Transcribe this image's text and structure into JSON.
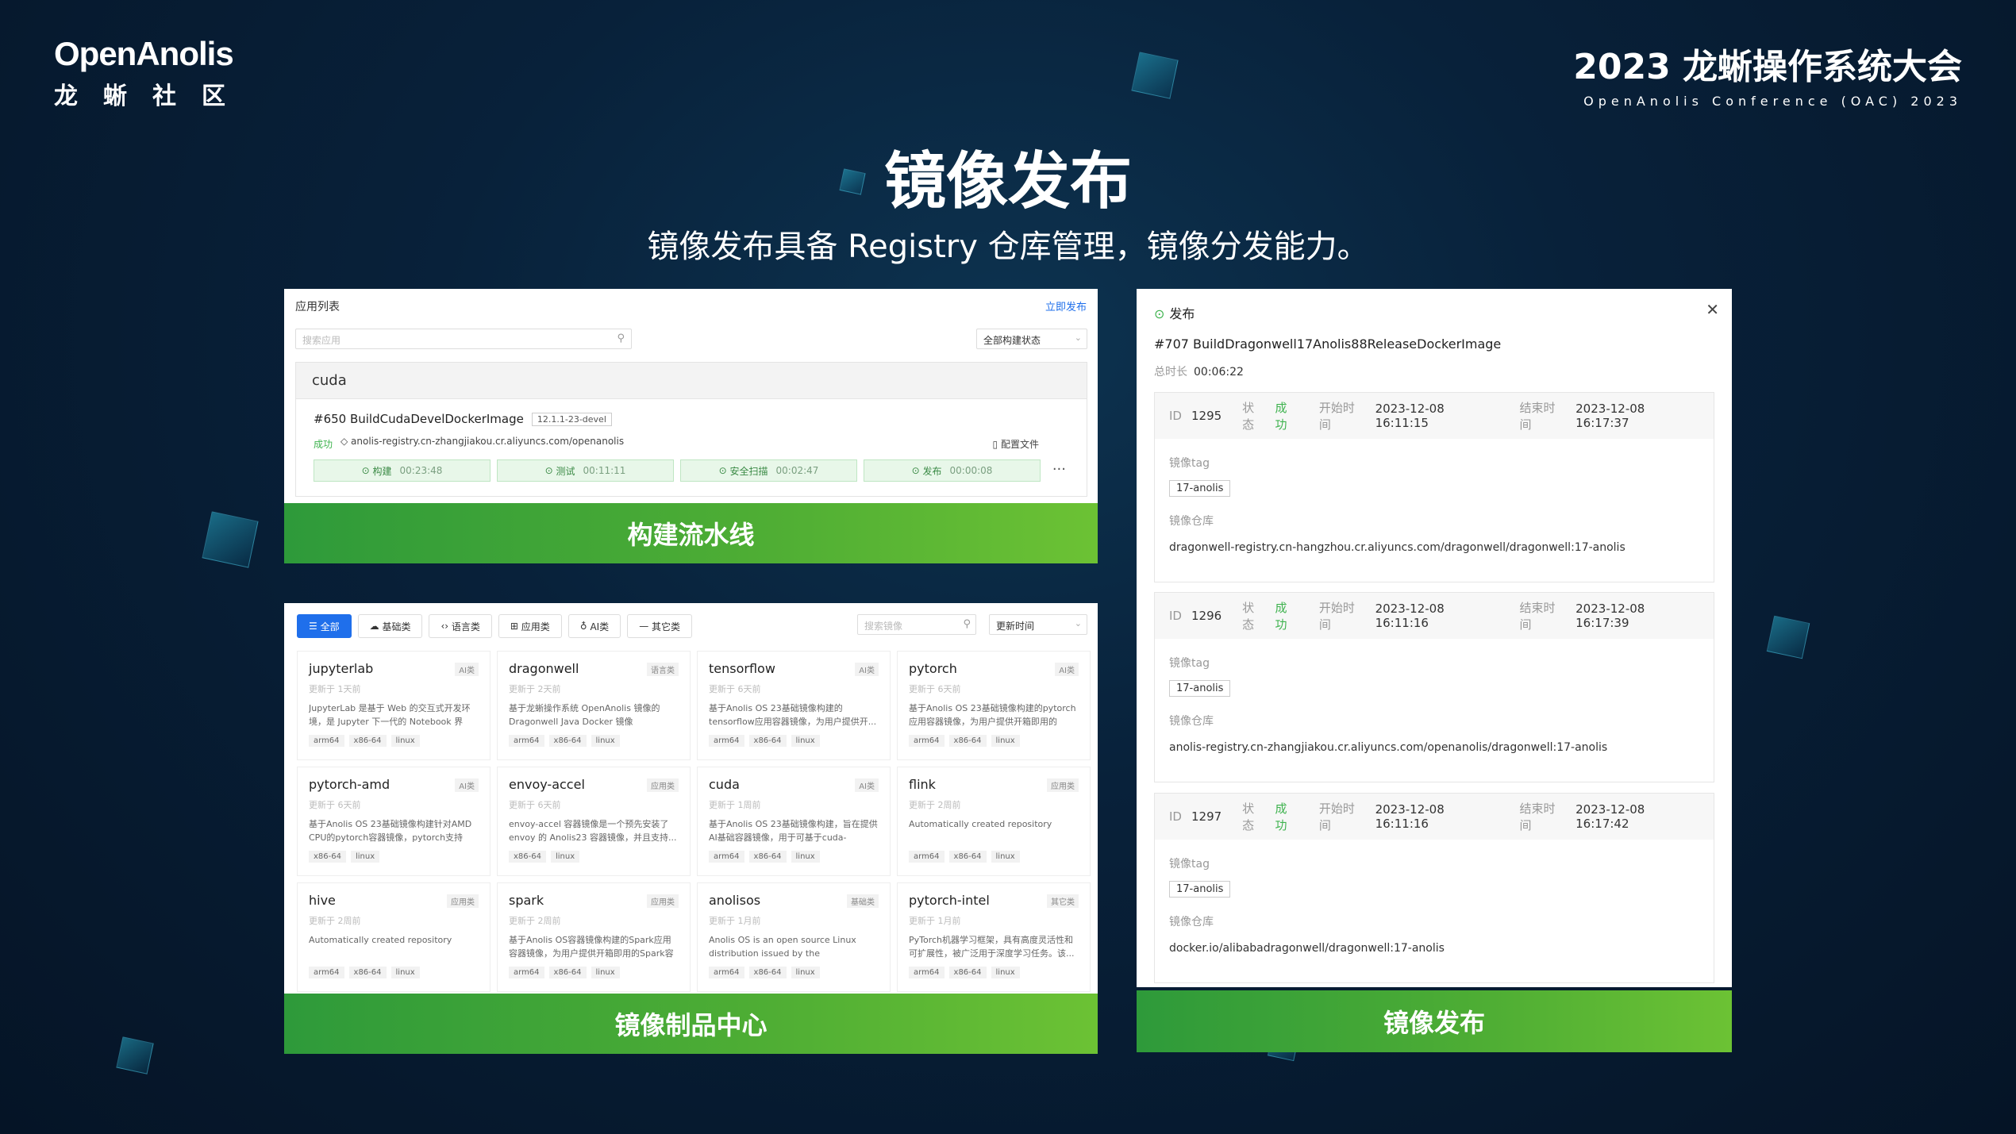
{
  "header": {
    "logo_en": "OpenAnolis",
    "logo_zh": "龙蜥社区",
    "conf_title": "2023 龙蜥操作系统大会",
    "conf_sub": "OpenAnolis Conference (OAC) 2023"
  },
  "title": "镜像发布",
  "subtitle": "镜像发布具备 Registry 仓库管理，镜像分发能力。",
  "pipeline": {
    "header": "应用列表",
    "publish_link": "立即发布",
    "search_placeholder": "搜索应用",
    "status_filter": "全部构建状态",
    "app_name": "cuda",
    "build_name": "#650 BuildCudaDevelDockerImage",
    "build_tag": "12.1.1-23-devel",
    "status": "成功",
    "repo": "anolis-registry.cn-zhangjiakou.cr.aliyuncs.com/openanolis",
    "config": "配置文件",
    "stages": [
      {
        "label": "构建",
        "time": "00:23:48"
      },
      {
        "label": "测试",
        "time": "00:11:11"
      },
      {
        "label": "安全扫描",
        "time": "00:02:47"
      },
      {
        "label": "发布",
        "time": "00:00:08"
      }
    ],
    "banner": "构建流水线"
  },
  "center": {
    "categories": [
      {
        "label": "全部"
      },
      {
        "label": "基础类"
      },
      {
        "label": "语言类"
      },
      {
        "label": "应用类"
      },
      {
        "label": "AI类"
      },
      {
        "label": "其它类"
      }
    ],
    "search_placeholder": "搜索镜像",
    "sort": "更新时间",
    "cards": [
      {
        "name": "jupyterlab",
        "badge": "AI类",
        "updated": "更新于 1天前",
        "desc": "JupyterLab 是基于 Web 的交互式开发环境，是 Jupyter 下一代的 Notebook 界面...",
        "arch": [
          "arm64",
          "x86-64",
          "linux"
        ]
      },
      {
        "name": "dragonwell",
        "badge": "语言类",
        "updated": "更新于 2天前",
        "desc": "基于龙蜥操作系统 OpenAnolis 镜像的 Dragonwell Java Docker 镜像",
        "arch": [
          "arm64",
          "x86-64",
          "linux"
        ]
      },
      {
        "name": "tensorflow",
        "badge": "AI类",
        "updated": "更新于 6天前",
        "desc": "基于Anolis OS 23基础镜像构建的tensorflow应用容器镜像，为用户提供开...",
        "arch": [
          "arm64",
          "x86-64",
          "linux"
        ]
      },
      {
        "name": "pytorch",
        "badge": "AI类",
        "updated": "更新于 6天前",
        "desc": "基于Anolis OS 23基础镜像构建的pytorch应用容器镜像，为用户提供开箱即用的pytor...",
        "arch": [
          "arm64",
          "x86-64",
          "linux"
        ]
      },
      {
        "name": "pytorch-amd",
        "badge": "AI类",
        "updated": "更新于 6天前",
        "desc": "基于Anolis OS 23基础镜像构建针对AMD CPU的pytorch容器镜像，pytorch支持基...",
        "arch": [
          "x86-64",
          "linux"
        ]
      },
      {
        "name": "envoy-accel",
        "badge": "应用类",
        "updated": "更新于 6天前",
        "desc": "envoy-accel 容器镜像是一个预先安装了envoy 的 Anolis23 容器镜像，并且支持...",
        "arch": [
          "x86-64",
          "linux"
        ]
      },
      {
        "name": "cuda",
        "badge": "AI类",
        "updated": "更新于 1周前",
        "desc": "基于Anolis OS 23基础镜像构建，旨在提供AI基础容器镜像，用于可基于cuda-runtim...",
        "arch": [
          "arm64",
          "x86-64",
          "linux"
        ]
      },
      {
        "name": "flink",
        "badge": "应用类",
        "updated": "更新于 2周前",
        "desc": "Automatically created repository",
        "arch": [
          "arm64",
          "x86-64",
          "linux"
        ]
      },
      {
        "name": "hive",
        "badge": "应用类",
        "updated": "更新于 2周前",
        "desc": "Automatically created repository",
        "arch": [
          "arm64",
          "x86-64",
          "linux"
        ]
      },
      {
        "name": "spark",
        "badge": "应用类",
        "updated": "更新于 2周前",
        "desc": "基于Anolis OS容器镜像构建的Spark应用容器镜像，为用户提供开箱即用的Spark容器...",
        "arch": [
          "arm64",
          "x86-64",
          "linux"
        ]
      },
      {
        "name": "anolisos",
        "badge": "基础类",
        "updated": "更新于 1月前",
        "desc": "Anolis OS is an open source Linux distribution issued by the OpenAnolis...",
        "arch": [
          "arm64",
          "x86-64",
          "linux"
        ]
      },
      {
        "name": "pytorch-intel",
        "badge": "其它类",
        "updated": "更新于 1月前",
        "desc": "PyTorch机器学习框架，具有高度灵活性和可扩展性，被广泛用于深度学习任务。该...",
        "arch": [
          "arm64",
          "x86-64",
          "linux"
        ]
      }
    ],
    "banner": "镜像制品中心"
  },
  "release": {
    "header": "发布",
    "title": "#707 BuildDragonwell17Anolis88ReleaseDockerImage",
    "duration_label": "总时长",
    "duration": "00:06:22",
    "labels": {
      "id": "ID",
      "status": "状态",
      "start": "开始时间",
      "end": "结束时间",
      "tag": "镜像tag",
      "repo": "镜像仓库"
    },
    "records": [
      {
        "id": "1295",
        "status": "成功",
        "start": "2023-12-08 16:11:15",
        "end": "2023-12-08 16:17:37",
        "tag": "17-anolis",
        "repo": "dragonwell-registry.cn-hangzhou.cr.aliyuncs.com/dragonwell/dragonwell:17-anolis"
      },
      {
        "id": "1296",
        "status": "成功",
        "start": "2023-12-08 16:11:16",
        "end": "2023-12-08 16:17:39",
        "tag": "17-anolis",
        "repo": "anolis-registry.cn-zhangjiakou.cr.aliyuncs.com/openanolis/dragonwell:17-anolis"
      },
      {
        "id": "1297",
        "status": "成功",
        "start": "2023-12-08 16:11:16",
        "end": "2023-12-08 16:17:42",
        "tag": "17-anolis",
        "repo": "docker.io/alibabadragonwell/dragonwell:17-anolis"
      }
    ],
    "banner": "镜像发布"
  }
}
